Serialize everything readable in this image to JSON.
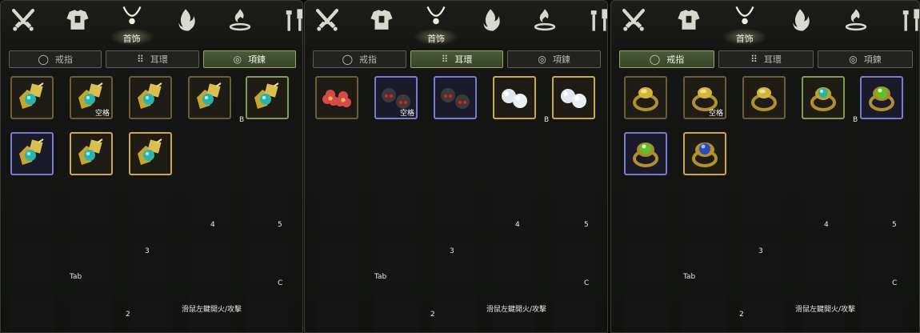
{
  "category_bar": {
    "active_label": "首饰",
    "icons": [
      "crossed-swords-icon",
      "armor-icon",
      "necklace-icon",
      "flame-icon",
      "fire-bowl-icon",
      "tools-icon"
    ]
  },
  "panels": [
    {
      "active_tab": 2,
      "tabs": [
        {
          "label": "戒指",
          "icon": "ring-icon"
        },
        {
          "label": "耳環",
          "icon": "earring-icon"
        },
        {
          "label": "項鍊",
          "icon": "necklace-icon"
        }
      ],
      "items": [
        {
          "kind": "amulet",
          "frame": "brown",
          "badge": ""
        },
        {
          "kind": "amulet",
          "frame": "brown",
          "badge": "空格"
        },
        {
          "kind": "amulet",
          "frame": "brown",
          "badge": ""
        },
        {
          "kind": "amulet",
          "frame": "brown",
          "badge": ""
        },
        {
          "kind": "amulet",
          "frame": "green",
          "badge": ""
        },
        {
          "kind": "amulet",
          "frame": "blue",
          "badge": ""
        },
        {
          "kind": "amulet",
          "frame": "gold",
          "badge": ""
        },
        {
          "kind": "amulet",
          "frame": "gold",
          "badge": ""
        }
      ]
    },
    {
      "active_tab": 1,
      "tabs": [
        {
          "label": "戒指",
          "icon": "ring-icon"
        },
        {
          "label": "耳環",
          "icon": "earring-icon"
        },
        {
          "label": "項鍊",
          "icon": "necklace-icon"
        }
      ],
      "items": [
        {
          "kind": "flower",
          "frame": "brown",
          "badge": ""
        },
        {
          "kind": "skull",
          "frame": "blue",
          "badge": "空格"
        },
        {
          "kind": "skull",
          "frame": "blue",
          "badge": ""
        },
        {
          "kind": "pearl",
          "frame": "gold",
          "badge": ""
        },
        {
          "kind": "pearl",
          "frame": "gold",
          "badge": ""
        }
      ]
    },
    {
      "active_tab": 0,
      "tabs": [
        {
          "label": "戒指",
          "icon": "ring-icon"
        },
        {
          "label": "耳環",
          "icon": "earring-icon"
        },
        {
          "label": "項鍊",
          "icon": "necklace-icon"
        }
      ],
      "items": [
        {
          "kind": "ring-gold",
          "frame": "brown",
          "badge": ""
        },
        {
          "kind": "ring-gold",
          "frame": "brown",
          "badge": "空格"
        },
        {
          "kind": "ring-gold",
          "frame": "brown",
          "badge": ""
        },
        {
          "kind": "ring-teal",
          "frame": "green",
          "badge": ""
        },
        {
          "kind": "ring-green",
          "frame": "blue",
          "badge": ""
        },
        {
          "kind": "ring-green",
          "frame": "blue",
          "badge": ""
        },
        {
          "kind": "ring-sapphire",
          "frame": "gold",
          "badge": ""
        }
      ]
    }
  ],
  "hotkeys": {
    "b": "B",
    "four": "4",
    "five": "5",
    "three": "3",
    "tab": "Tab",
    "c": "C",
    "two": "2",
    "hint": "滑鼠左鍵開火/攻擊"
  },
  "colors": {
    "gold": "#c9a94b",
    "blue": "#7a7ad0",
    "green": "#7f9a55",
    "brown": "#6c5d3a",
    "active_tab": "#4a5a36"
  }
}
